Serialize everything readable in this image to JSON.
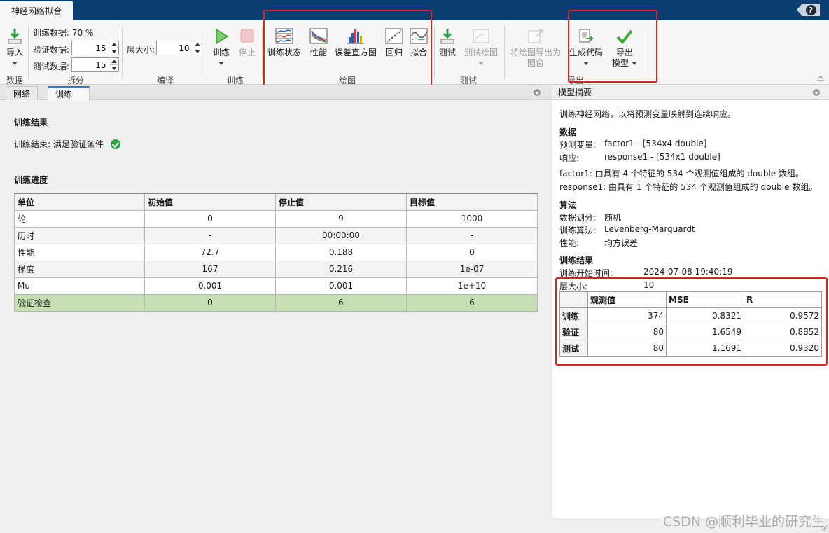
{
  "app": {
    "tab_title": "神经网络拟合",
    "help_label": "?"
  },
  "toolstrip": {
    "import": {
      "label": "导入"
    },
    "data_group": "数据",
    "split": {
      "group": "拆分",
      "train_label": "训练数据: 70 %",
      "val_label": "验证数据:",
      "val_value": "15",
      "test_label": "测试数据:",
      "test_value": "15"
    },
    "compile": {
      "group": "编译",
      "layer_label": "层大小:",
      "layer_value": "10"
    },
    "train": {
      "group": "训练",
      "train_label": "训练",
      "stop_label": "停止"
    },
    "plots": {
      "group": "绘图",
      "training_state": "训练状态",
      "performance": "性能",
      "error_hist": "误差直方图",
      "regression": "回归",
      "fit": "拟合"
    },
    "test": {
      "group": "测试",
      "test_label": "测试",
      "test_plot": "测试绘图"
    },
    "export": {
      "group": "导出",
      "export_plot_line1": "将绘图导出为",
      "export_plot_line2": "图窗",
      "gen_code": "生成代码",
      "export_model_line1": "导出",
      "export_model_line2": "模型"
    }
  },
  "left": {
    "tabs": [
      "网络",
      "训练"
    ],
    "results_title": "训练结果",
    "result_text": "训练结束: 满足验证条件",
    "progress_title": "训练进度",
    "table": {
      "headers": [
        "单位",
        "初始值",
        "停止值",
        "目标值"
      ],
      "rows": [
        [
          "轮",
          "0",
          "9",
          "1000"
        ],
        [
          "历时",
          "-",
          "00:00:00",
          "-"
        ],
        [
          "性能",
          "72.7",
          "0.188",
          "0"
        ],
        [
          "梯度",
          "167",
          "0.216",
          "1e-07"
        ],
        [
          "Mu",
          "0.001",
          "0.001",
          "1e+10"
        ],
        [
          "验证检查",
          "0",
          "6",
          "6"
        ]
      ]
    }
  },
  "right": {
    "header": "模型摘要",
    "intro": "训练神经网络，以将预测变量映射到连续响应。",
    "data_title": "数据",
    "predictor_key": "预测变量:",
    "predictor_val": "factor1 - [534x4 double]",
    "response_key": "响应:",
    "response_val": "response1 - [534x1 double]",
    "factor_desc": "factor1: 由具有 4 个特征的 534 个观测值组成的 double 数组。",
    "response_desc": "response1: 由具有 1 个特征的 534 个观测值组成的 double 数组。",
    "algo_title": "算法",
    "division_key": "数据划分:",
    "division_val": "随机",
    "trainalgo_key": "训练算法:",
    "trainalgo_val": "Levenberg-Marquardt",
    "perf_key": "性能:",
    "perf_val": "均方误差",
    "results_title": "训练结果",
    "start_key": "训练开始时间:",
    "start_val": "2024-07-08 19:40:19",
    "layer_key": "层大小:",
    "layer_val": "10",
    "summary": {
      "headers": [
        "",
        "观测值",
        "MSE",
        "R"
      ],
      "rows": [
        [
          "训练",
          "374",
          "0.8321",
          "0.9572"
        ],
        [
          "验证",
          "80",
          "1.6549",
          "0.8852"
        ],
        [
          "测试",
          "80",
          "1.1691",
          "0.9320"
        ]
      ]
    },
    "watermark": "CSDN @顺利毕业的研究生"
  }
}
